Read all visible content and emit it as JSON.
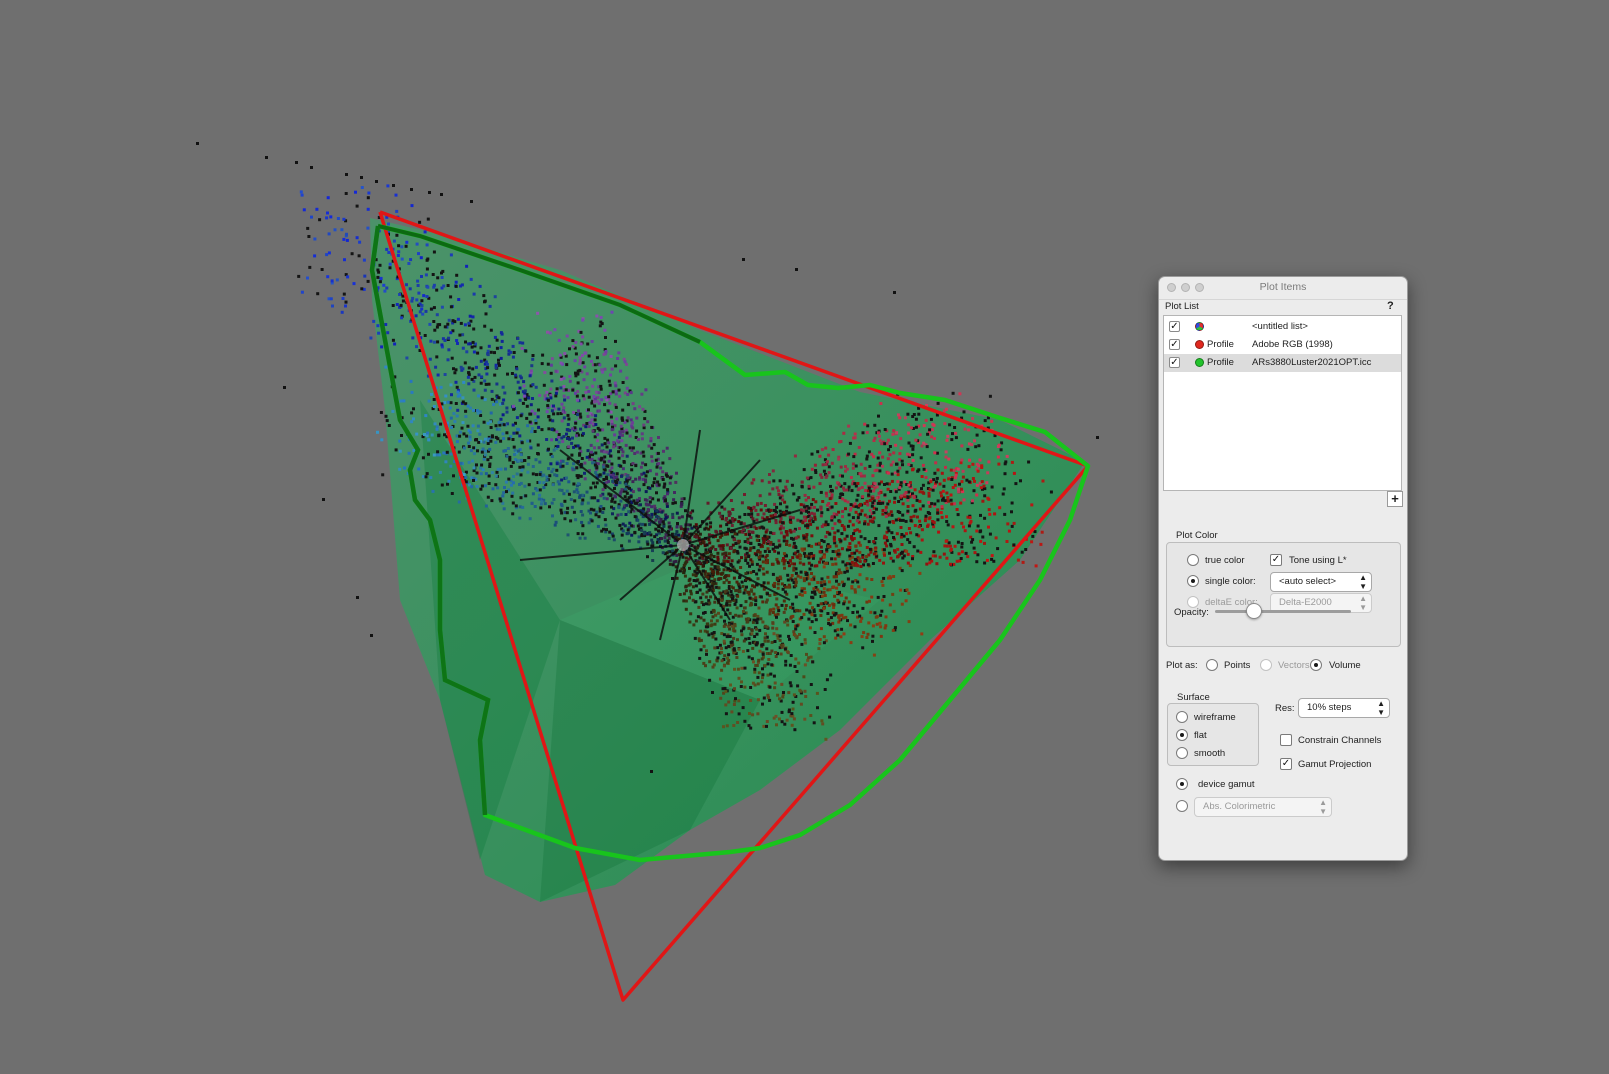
{
  "colors": {
    "background": "#6f6f6f",
    "gamut_volume": "#1f9a52",
    "adobe_rgb_outline": "#e01616",
    "printer_outline": "#19c21c"
  },
  "panel": {
    "title": "Plot Items",
    "plot_list_label": "Plot List",
    "help_label": "?",
    "add_button_label": "+",
    "rows": [
      {
        "checked": true,
        "icon": "multicolor-swatch-icon",
        "kind": "",
        "name": "<untitled list>"
      },
      {
        "checked": true,
        "icon": "red-dot-icon",
        "color": "#e0281e",
        "kind": "Profile",
        "name": "Adobe RGB (1998)"
      },
      {
        "checked": true,
        "icon": "green-dot-icon",
        "color": "#22c32b",
        "kind": "Profile",
        "name": "ARs3880Luster2021OPT.icc"
      }
    ],
    "plot_color": {
      "label": "Plot Color",
      "true_color": "true color",
      "single_color": "single color:",
      "single_color_value": "<auto select>",
      "deltae_color": "deltaE color:",
      "deltae_value": "Delta-E2000",
      "tone_using": "Tone using L*",
      "tone_checked": true,
      "selected": "single color",
      "opacity_label": "Opacity:",
      "opacity_fraction": 0.29
    },
    "plot_as": {
      "label": "Plot as:",
      "points": "Points",
      "vectors": "Vectors",
      "volume": "Volume",
      "selected": "Volume"
    },
    "surface": {
      "label": "Surface",
      "wireframe": "wireframe",
      "flat": "flat",
      "smooth": "smooth",
      "selected": "flat"
    },
    "res": {
      "label": "Res:",
      "value": "10% steps"
    },
    "constrain_channels": {
      "label": "Constrain Channels",
      "checked": false
    },
    "gamut_projection": {
      "label": "Gamut Projection",
      "checked": true
    },
    "gamut_mode": {
      "device_gamut": "device gamut",
      "intent_value": "Abs. Colorimetric",
      "selected": "device gamut"
    }
  }
}
